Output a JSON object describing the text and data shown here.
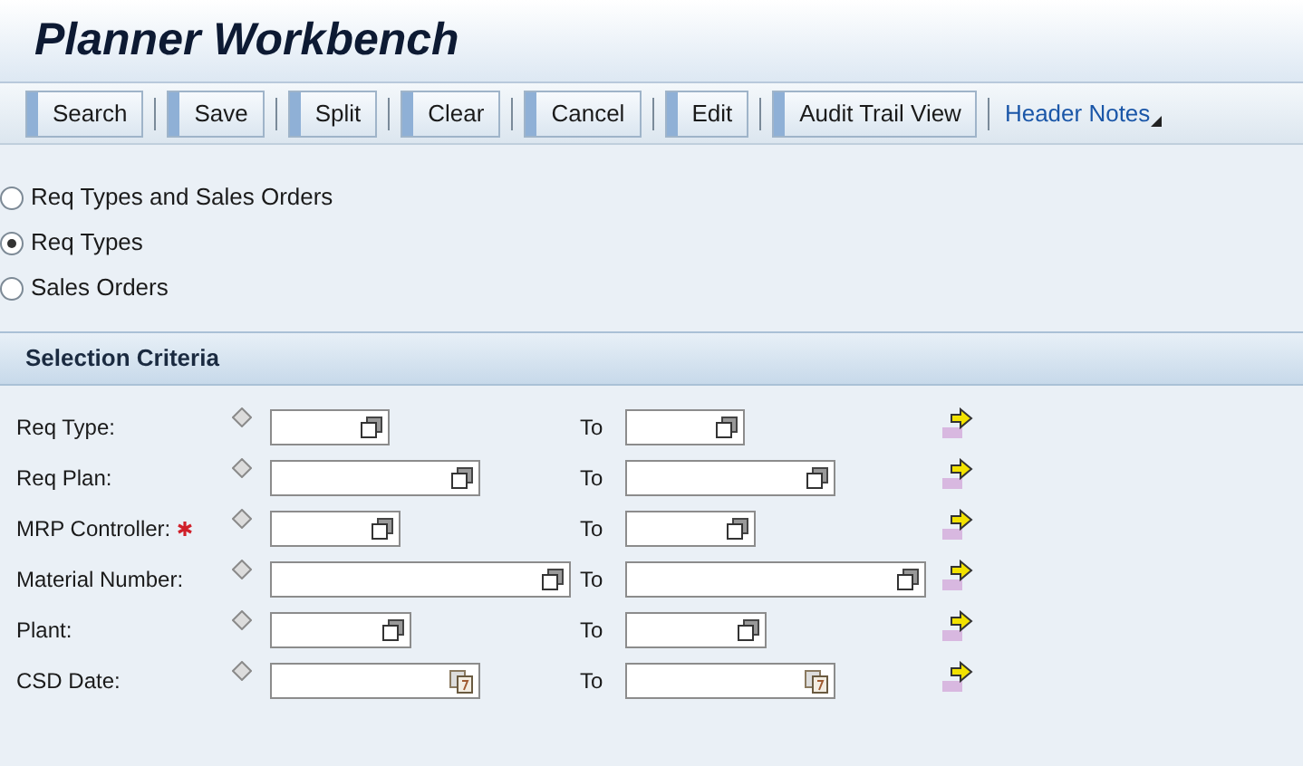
{
  "window": {
    "title": "Planner Workbench"
  },
  "toolbar": [
    {
      "kind": "button",
      "label": "Search"
    },
    {
      "kind": "button",
      "label": "Save"
    },
    {
      "kind": "button",
      "label": "Split"
    },
    {
      "kind": "button",
      "label": "Clear"
    },
    {
      "kind": "button",
      "label": "Cancel"
    },
    {
      "kind": "button",
      "label": "Edit"
    },
    {
      "kind": "button",
      "label": "Audit Trail View"
    },
    {
      "kind": "menu",
      "label": "Header Notes"
    }
  ],
  "options": [
    {
      "label": "Req Types and Sales Orders",
      "selected": false
    },
    {
      "label": "Req Types",
      "selected": true
    },
    {
      "label": "Sales Orders",
      "selected": false
    }
  ],
  "section": {
    "title": "Selection Criteria"
  },
  "criteria": [
    {
      "label": "Req Type:",
      "required": false,
      "kind": "lookup",
      "to_label": "To"
    },
    {
      "label": "Req Plan:",
      "required": false,
      "kind": "lookup",
      "to_label": "To"
    },
    {
      "label": "MRP Controller:",
      "required": true,
      "kind": "lookup",
      "to_label": "To"
    },
    {
      "label": "Material Number:",
      "required": false,
      "kind": "lookup",
      "to_label": "To"
    },
    {
      "label": "Plant:",
      "required": false,
      "kind": "lookup",
      "to_label": "To"
    },
    {
      "label": "CSD Date:",
      "required": false,
      "kind": "date",
      "to_label": "To"
    }
  ]
}
